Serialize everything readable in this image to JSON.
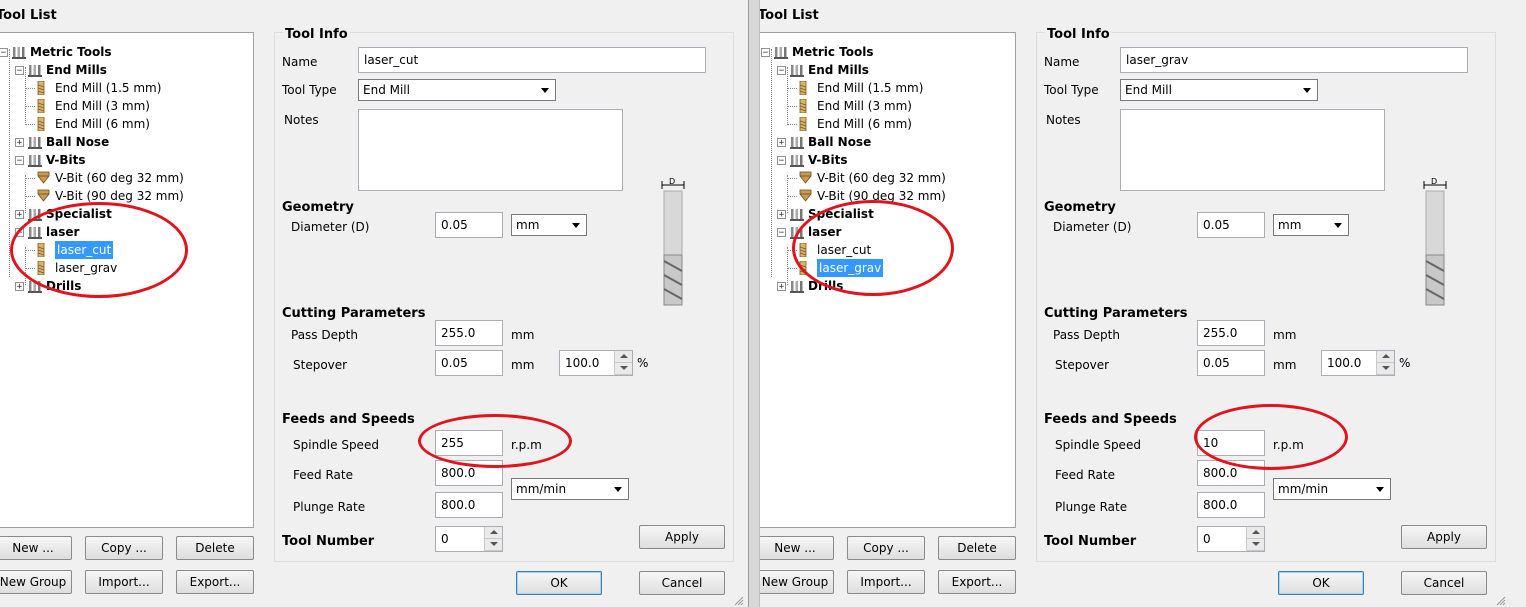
{
  "panels": [
    {
      "tool_list_title": "Tool List",
      "tree": [
        {
          "label": "Metric Tools",
          "type": "group",
          "level": 0,
          "expanded": true
        },
        {
          "label": "End Mills",
          "type": "group",
          "level": 1,
          "expanded": true
        },
        {
          "label": "End Mill (1.5 mm)",
          "type": "tool",
          "level": 2,
          "icon": "end-mill-icon"
        },
        {
          "label": "End Mill (3 mm)",
          "type": "tool",
          "level": 2,
          "icon": "end-mill-icon"
        },
        {
          "label": "End Mill (6 mm)",
          "type": "tool",
          "level": 2,
          "icon": "end-mill-icon"
        },
        {
          "label": "Ball Nose",
          "type": "group",
          "level": 1,
          "expanded": false
        },
        {
          "label": "V-Bits",
          "type": "group",
          "level": 1,
          "expanded": true
        },
        {
          "label": "V-Bit (60 deg 32 mm)",
          "type": "tool",
          "level": 2,
          "icon": "v-bit-icon"
        },
        {
          "label": "V-Bit (90 deg 32 mm)",
          "type": "tool",
          "level": 2,
          "icon": "v-bit-icon"
        },
        {
          "label": "Specialist",
          "type": "group",
          "level": 1,
          "expanded": false
        },
        {
          "label": "laser",
          "type": "group",
          "level": 1,
          "expanded": true
        },
        {
          "label": "laser_cut",
          "type": "tool",
          "level": 2,
          "icon": "end-mill-icon",
          "selected": true
        },
        {
          "label": "laser_grav",
          "type": "tool",
          "level": 2,
          "icon": "end-mill-icon",
          "selected": false
        },
        {
          "label": "Drills",
          "type": "group",
          "level": 1,
          "expanded": false
        }
      ],
      "list_buttons": {
        "new": "New ...",
        "copy": "Copy ...",
        "delete": "Delete",
        "new_group": "New Group",
        "import": "Import...",
        "export": "Export..."
      },
      "tool_info": {
        "title": "Tool Info",
        "name_label": "Name",
        "name_value": "laser_cut",
        "tool_type_label": "Tool Type",
        "tool_type_value": "End Mill",
        "notes_label": "Notes",
        "notes_value": "",
        "geometry_title": "Geometry",
        "diameter_label": "Diameter (D)",
        "diameter_value": "0.05",
        "diameter_unit": "mm",
        "cutting_title": "Cutting Parameters",
        "pass_depth_label": "Pass Depth",
        "pass_depth_value": "255.0",
        "pass_depth_unit": "mm",
        "stepover_label": "Stepover",
        "stepover_value": "0.05",
        "stepover_unit": "mm",
        "stepover_pct_value": "100.0",
        "stepover_pct_unit": "%",
        "feeds_title": "Feeds and Speeds",
        "spindle_label": "Spindle Speed",
        "spindle_value": "255",
        "spindle_unit": "r.p.m",
        "feed_label": "Feed Rate",
        "feed_value": "800.0",
        "plunge_label": "Plunge Rate",
        "plunge_value": "800.0",
        "rate_unit": "mm/min",
        "tool_number_label": "Tool Number",
        "tool_number_value": "0",
        "apply": "Apply",
        "diagram_d": "D"
      },
      "dialog_buttons": {
        "ok": "OK",
        "cancel": "Cancel"
      }
    },
    {
      "tool_list_title": "Tool List",
      "tree": [
        {
          "label": "Metric Tools",
          "type": "group",
          "level": 0,
          "expanded": true
        },
        {
          "label": "End Mills",
          "type": "group",
          "level": 1,
          "expanded": true
        },
        {
          "label": "End Mill (1.5 mm)",
          "type": "tool",
          "level": 2,
          "icon": "end-mill-icon"
        },
        {
          "label": "End Mill (3 mm)",
          "type": "tool",
          "level": 2,
          "icon": "end-mill-icon"
        },
        {
          "label": "End Mill (6 mm)",
          "type": "tool",
          "level": 2,
          "icon": "end-mill-icon"
        },
        {
          "label": "Ball Nose",
          "type": "group",
          "level": 1,
          "expanded": false
        },
        {
          "label": "V-Bits",
          "type": "group",
          "level": 1,
          "expanded": true
        },
        {
          "label": "V-Bit (60 deg 32 mm)",
          "type": "tool",
          "level": 2,
          "icon": "v-bit-icon"
        },
        {
          "label": "V-Bit (90 deg 32 mm)",
          "type": "tool",
          "level": 2,
          "icon": "v-bit-icon"
        },
        {
          "label": "Specialist",
          "type": "group",
          "level": 1,
          "expanded": false
        },
        {
          "label": "laser",
          "type": "group",
          "level": 1,
          "expanded": true
        },
        {
          "label": "laser_cut",
          "type": "tool",
          "level": 2,
          "icon": "end-mill-icon",
          "selected": false
        },
        {
          "label": "laser_grav",
          "type": "tool",
          "level": 2,
          "icon": "end-mill-icon",
          "selected": true
        },
        {
          "label": "Drills",
          "type": "group",
          "level": 1,
          "expanded": false
        }
      ],
      "list_buttons": {
        "new": "New ...",
        "copy": "Copy ...",
        "delete": "Delete",
        "new_group": "New Group",
        "import": "Import...",
        "export": "Export..."
      },
      "tool_info": {
        "title": "Tool Info",
        "name_label": "Name",
        "name_value": "laser_grav",
        "tool_type_label": "Tool Type",
        "tool_type_value": "End Mill",
        "notes_label": "Notes",
        "notes_value": "",
        "geometry_title": "Geometry",
        "diameter_label": "Diameter (D)",
        "diameter_value": "0.05",
        "diameter_unit": "mm",
        "cutting_title": "Cutting Parameters",
        "pass_depth_label": "Pass Depth",
        "pass_depth_value": "255.0",
        "pass_depth_unit": "mm",
        "stepover_label": "Stepover",
        "stepover_value": "0.05",
        "stepover_unit": "mm",
        "stepover_pct_value": "100.0",
        "stepover_pct_unit": "%",
        "feeds_title": "Feeds and Speeds",
        "spindle_label": "Spindle Speed",
        "spindle_value": "10",
        "spindle_unit": "r.p.m",
        "feed_label": "Feed Rate",
        "feed_value": "800.0",
        "plunge_label": "Plunge Rate",
        "plunge_value": "800.0",
        "rate_unit": "mm/min",
        "tool_number_label": "Tool Number",
        "tool_number_value": "0",
        "apply": "Apply",
        "diagram_d": "D"
      },
      "dialog_buttons": {
        "ok": "OK",
        "cancel": "Cancel"
      }
    }
  ],
  "colors": {
    "highlight": "#3399ff",
    "annotation_oval": "#e0141c",
    "window_bg": "#f0f0f0"
  }
}
